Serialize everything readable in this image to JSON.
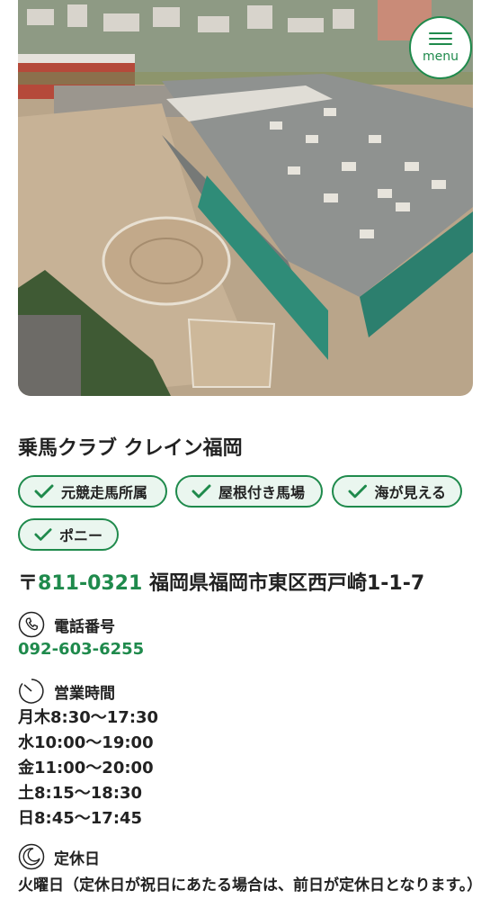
{
  "menu": {
    "label": "menu"
  },
  "club": {
    "name": "乗馬クラブ クレイン福岡"
  },
  "tags": [
    {
      "label": "元競走馬所属"
    },
    {
      "label": "屋根付き馬場"
    },
    {
      "label": "海が見える"
    },
    {
      "label": "ポニー"
    }
  ],
  "address": {
    "zip_mark": "〒",
    "zip": "811-0321",
    "text": "福岡県福岡市東区西戸崎1-1-7"
  },
  "phone": {
    "heading": "電話番号",
    "number": "092-603-6255"
  },
  "hours": {
    "heading": "営業時間",
    "rows": [
      "月木8:30〜17:30",
      "水10:00〜19:00",
      "金11:00〜20:00",
      "土8:15〜18:30",
      "日8:45〜17:45"
    ]
  },
  "closed": {
    "heading": "定休日",
    "text": "火曜日（定休日が祝日にあたる場合は、前日が定休日となります。）"
  },
  "colors": {
    "accent": "#1f8a4c",
    "tag_bg": "#eaf6ef"
  }
}
